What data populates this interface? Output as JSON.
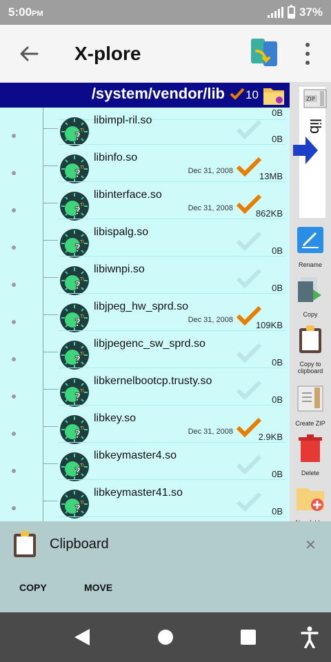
{
  "status_bar": {
    "time": "5:00",
    "ampm": "PM",
    "battery": "37%"
  },
  "app_bar": {
    "title": "X-plore"
  },
  "path_bar": {
    "path": "/system/vendor/lib",
    "selected_count": "10"
  },
  "partial_row_size": "0B",
  "files": [
    {
      "name": "libimpl-ril.so",
      "date": "",
      "size": "0B",
      "checked": false
    },
    {
      "name": "libinfo.so",
      "date": "Dec 31, 2008",
      "size": "13MB",
      "checked": true
    },
    {
      "name": "libinterface.so",
      "date": "Dec 31, 2008",
      "size": "862KB",
      "checked": true
    },
    {
      "name": "libispalg.so",
      "date": "",
      "size": "0B",
      "checked": false
    },
    {
      "name": "libiwnpi.so",
      "date": "",
      "size": "0B",
      "checked": false
    },
    {
      "name": "libjpeg_hw_sprd.so",
      "date": "Dec 31, 2008",
      "size": "109KB",
      "checked": true
    },
    {
      "name": "libjpegenc_sw_sprd.so",
      "date": "",
      "size": "0B",
      "checked": false
    },
    {
      "name": "libkernelbootcp.trusty.so",
      "date": "",
      "size": "0B",
      "checked": false
    },
    {
      "name": "libkey.so",
      "date": "Dec 31, 2008",
      "size": "2.9KB",
      "checked": true
    },
    {
      "name": "libkeymaster4.so",
      "date": "",
      "size": "0B",
      "checked": false
    },
    {
      "name": "libkeymaster41.so",
      "date": "",
      "size": "0B",
      "checked": false
    }
  ],
  "side_panel": {
    "tab_label": "lib",
    "actions": [
      {
        "label": "Rename",
        "icon": "rename-icon"
      },
      {
        "label": "Copy",
        "icon": "copy-icon"
      },
      {
        "label": "Copy to clipboard",
        "icon": "clipboard-icon"
      },
      {
        "label": "Create ZIP",
        "icon": "zip-icon"
      },
      {
        "label": "Delete",
        "icon": "trash-icon"
      },
      {
        "label": "New folder",
        "icon": "new-folder-icon"
      }
    ]
  },
  "clipboard": {
    "title": "Clipboard",
    "copy_label": "COPY",
    "move_label": "MOVE"
  },
  "colors": {
    "path_bar": "#0a0a8a",
    "list_bg": "#cffafa",
    "check_orange": "#e67e00",
    "check_faded": "#b9e6e6"
  }
}
